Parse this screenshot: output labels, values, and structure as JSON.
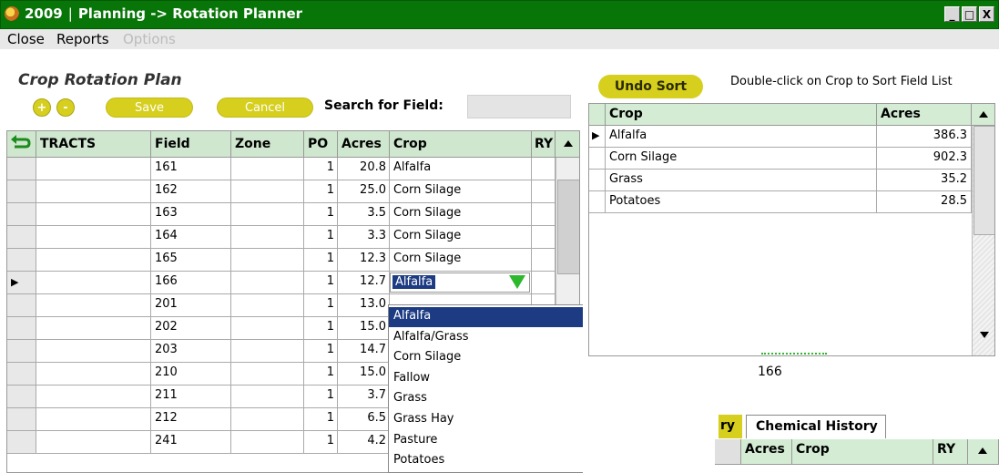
{
  "window": {
    "title_year": "2009",
    "title_sep": "|",
    "title_path": "Planning -> Rotation Planner",
    "buttons": [
      "_",
      "□",
      "X"
    ]
  },
  "menu": [
    "Close",
    "Reports",
    "Options"
  ],
  "plan": {
    "title": "Crop Rotation Plan",
    "add_label": "+",
    "remove_label": "-",
    "save_label": "Save",
    "cancel_label": "Cancel",
    "search_label": "Search for Field:",
    "search_value": ""
  },
  "grid": {
    "columns": [
      "TRACTS",
      "Field",
      "Zone",
      "PO",
      "Acres",
      "Crop",
      "RY"
    ],
    "rows": [
      {
        "field": "161",
        "zone": "",
        "po": "1",
        "acres": "20.8",
        "crop": "Alfalfa"
      },
      {
        "field": "162",
        "zone": "",
        "po": "1",
        "acres": "25.0",
        "crop": "Corn Silage"
      },
      {
        "field": "163",
        "zone": "",
        "po": "1",
        "acres": "3.5",
        "crop": "Corn Silage"
      },
      {
        "field": "164",
        "zone": "",
        "po": "1",
        "acres": "3.3",
        "crop": "Corn Silage"
      },
      {
        "field": "165",
        "zone": "",
        "po": "1",
        "acres": "12.3",
        "crop": "Corn Silage"
      },
      {
        "field": "166",
        "zone": "",
        "po": "1",
        "acres": "12.7",
        "crop": "Alfalfa"
      },
      {
        "field": "201",
        "zone": "",
        "po": "1",
        "acres": "13.0",
        "crop": ""
      },
      {
        "field": "202",
        "zone": "",
        "po": "1",
        "acres": "15.0",
        "crop": ""
      },
      {
        "field": "203",
        "zone": "",
        "po": "1",
        "acres": "14.7",
        "crop": ""
      },
      {
        "field": "210",
        "zone": "",
        "po": "1",
        "acres": "15.0",
        "crop": ""
      },
      {
        "field": "211",
        "zone": "",
        "po": "1",
        "acres": "3.7",
        "crop": ""
      },
      {
        "field": "212",
        "zone": "",
        "po": "1",
        "acres": "6.5",
        "crop": ""
      },
      {
        "field": "241",
        "zone": "",
        "po": "1",
        "acres": "4.2",
        "crop": ""
      }
    ],
    "current_row_marker": "▶",
    "editing_crop": "Alfalfa"
  },
  "crop_dropdown": {
    "options": [
      "Alfalfa",
      "Alfalfa/Grass",
      "Corn Silage",
      "Fallow",
      "Grass",
      "Grass Hay",
      "Pasture",
      "Potatoes"
    ],
    "selected": "Alfalfa"
  },
  "summary": {
    "undo_label": "Undo Sort",
    "hint": "Double-click on Crop to Sort Field List",
    "columns": [
      "Crop",
      "Acres"
    ],
    "rows": [
      {
        "crop": "Alfalfa",
        "acres": "386.3"
      },
      {
        "crop": "Corn Silage",
        "acres": "902.3"
      },
      {
        "crop": "Grass",
        "acres": "35.2"
      },
      {
        "crop": "Potatoes",
        "acres": "28.5"
      }
    ],
    "current_row_marker": "▶"
  },
  "detail": {
    "field_number": "166",
    "tabs": [
      "ry",
      "Chemical History"
    ],
    "columns": [
      "Acres",
      "Crop",
      "RY"
    ]
  },
  "colors": {
    "title_bar": "#077507",
    "accent_button": "#d6cf1e",
    "header_green": "#cfe6cf",
    "selection": "#1c3b82"
  }
}
